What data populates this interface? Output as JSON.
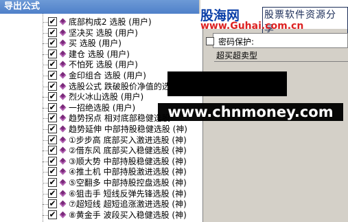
{
  "window": {
    "title": "导出公式"
  },
  "logo": {
    "brand": "股海网",
    "tagline": "股票软件资源分享",
    "url": "www.Guhai.com.cn"
  },
  "password": {
    "checkbox_label": "密码保护:"
  },
  "formula_type": "超买超卖型",
  "watermark": "www.chnmoney.com",
  "tree": {
    "items": [
      {
        "label": "底部构成2 选股 (用户)",
        "checked": "✔"
      },
      {
        "label": "坚决买 选股 (用户)",
        "checked": "✔"
      },
      {
        "label": "买 选股 (用户)",
        "checked": "✔"
      },
      {
        "label": "建仓 选股 (用户)",
        "checked": "✔"
      },
      {
        "label": "不怕死 选股 (用户)",
        "checked": "✔"
      },
      {
        "label": "金印组合 选股 (用户)",
        "checked": "✔"
      },
      {
        "label": "选股公式 跌破股价净值的选股公式",
        "checked": "✔"
      },
      {
        "label": "烈火冰山选股 (用户)",
        "checked": "✔"
      },
      {
        "label": "一招绝选股 (用户)",
        "checked": "✔"
      },
      {
        "label": "趋势拐点 相对底部稳健选股",
        "checked": "✔"
      },
      {
        "label": "趋势延伸 中部持股稳健选股 (神)",
        "checked": "✔"
      },
      {
        "label": "①步步高 底部买入激进选股 (神)",
        "checked": "✔"
      },
      {
        "label": "②借东风 底部买入稳健选股 (神)",
        "checked": "✔"
      },
      {
        "label": "③顺大势 中部持股稳健选股 (神)",
        "checked": "✔"
      },
      {
        "label": "④推土机 中部持股激进选股 (神)",
        "checked": "✔"
      },
      {
        "label": "⑤空翻多 中部持股控盘选股 (神)",
        "checked": "✔"
      },
      {
        "label": "⑥狙击手 短线反弹先锋选股 (神)",
        "checked": "✔"
      },
      {
        "label": "⑦超短线 超短追涨激进选股 (神)",
        "checked": "✔"
      },
      {
        "label": "⑧黄金手 波段买入稳健选股 (神)",
        "checked": "✔"
      }
    ]
  }
}
